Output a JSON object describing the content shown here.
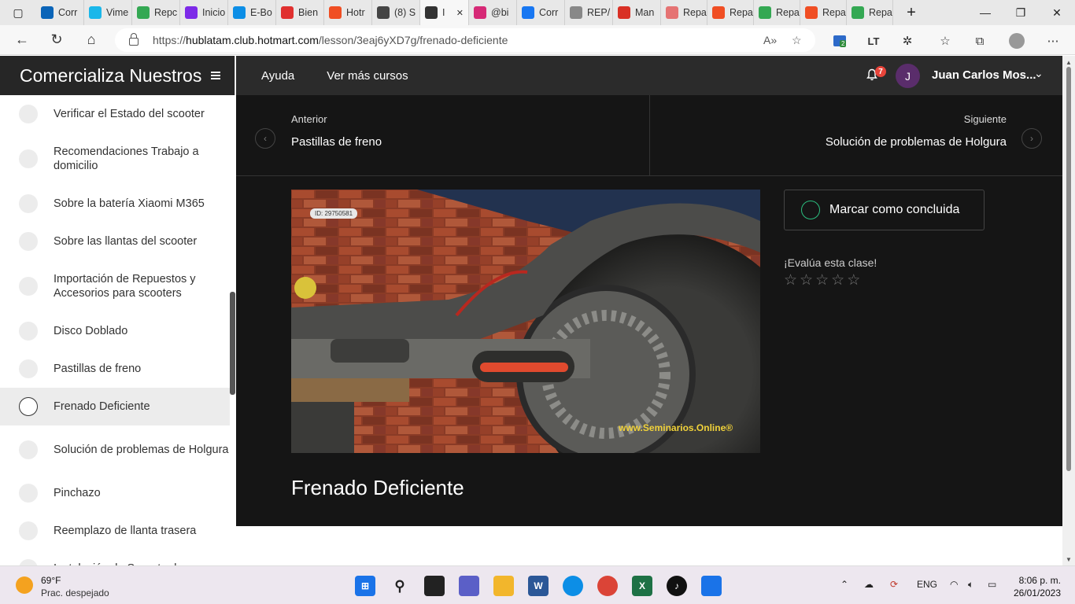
{
  "browser": {
    "tabs": [
      {
        "label": "Corr",
        "fav": "outlook-icon",
        "color": "#0a64b8"
      },
      {
        "label": "Vime",
        "fav": "vimeo-icon",
        "color": "#1ab7ea"
      },
      {
        "label": "Repc",
        "fav": "drive-icon",
        "color": "#34a853"
      },
      {
        "label": "Inicio",
        "fav": "canva-icon",
        "color": "#7d2ae8"
      },
      {
        "label": "E-Bo",
        "fav": "edge-icon",
        "color": "#0c8ee6"
      },
      {
        "label": "Bien",
        "fav": "youtube-icon",
        "color": "#e0302f"
      },
      {
        "label": "Hotr",
        "fav": "hotmart-icon",
        "color": "#f04e23"
      },
      {
        "label": "(8) S",
        "fav": "m-icon",
        "color": "#444444"
      },
      {
        "label": "I",
        "fav": "speaker-icon",
        "color": "#333333",
        "active": true
      },
      {
        "label": "@bi",
        "fav": "instagram-icon",
        "color": "#d62976"
      },
      {
        "label": "Corr",
        "fav": "facebook-icon",
        "color": "#1877f2"
      },
      {
        "label": "REP/",
        "fav": "page-icon",
        "color": "#888888"
      },
      {
        "label": "Man",
        "fav": "pdf-icon",
        "color": "#d93025"
      },
      {
        "label": "Repa",
        "fav": "circle-icon",
        "color": "#e57373"
      },
      {
        "label": "Repa",
        "fav": "hotmart-icon",
        "color": "#f04e23"
      },
      {
        "label": "Repa",
        "fav": "drive-icon",
        "color": "#34a853"
      },
      {
        "label": "Repa",
        "fav": "hotmart-icon",
        "color": "#f04e23"
      },
      {
        "label": "Repa",
        "fav": "drive-icon",
        "color": "#34a853"
      }
    ],
    "url_prefix": "https://",
    "url_host": "hublatam.club.hotmart.com",
    "url_path": "/lesson/3eaj6yXD7g/frenado-deficiente",
    "ext_badge": "2"
  },
  "sidebar": {
    "brand": "Comercializa Nuestros",
    "lessons": [
      {
        "label": "Verificar el Estado del scooter",
        "active": false
      },
      {
        "label": "Recomendaciones Trabajo a domicilio",
        "active": false
      },
      {
        "label": "Sobre la batería Xiaomi M365",
        "active": false
      },
      {
        "label": "Sobre las llantas del scooter",
        "active": false
      },
      {
        "label": "Importación de Repuestos y Accesorios para scooters",
        "active": false
      },
      {
        "label": "Disco Doblado",
        "active": false
      },
      {
        "label": "Pastillas de freno",
        "active": false
      },
      {
        "label": "Frenado Deficiente",
        "active": true
      },
      {
        "label": "Solución de problemas de Holgura",
        "active": false
      },
      {
        "label": "Pinchazo",
        "active": false
      },
      {
        "label": "Reemplazo de llanta trasera",
        "active": false
      },
      {
        "label": "Instalación de Soporte de",
        "active": false
      }
    ]
  },
  "topbar": {
    "help": "Ayuda",
    "more_courses": "Ver más cursos",
    "notif_count": "7",
    "avatar_initial": "J",
    "username": "Juan Carlos Mos..."
  },
  "pager": {
    "prev_kicker": "Anterior",
    "prev_title": "Pastillas de freno",
    "next_kicker": "Siguiente",
    "next_title": "Solución de problemas de Holgura"
  },
  "video": {
    "id_label": "ID: 29750581",
    "watermark": "www.Seminarios.Online®"
  },
  "lesson": {
    "mark_complete": "Marcar como concluida",
    "rate_label": "¡Evalúa esta clase!",
    "rating": 0,
    "rating_max": 5,
    "title": "Frenado Deficiente"
  },
  "taskbar": {
    "temperature": "69°F",
    "weather": "Prac. despejado",
    "language": "ENG",
    "time": "8:06 p. m.",
    "date": "26/01/2023"
  }
}
